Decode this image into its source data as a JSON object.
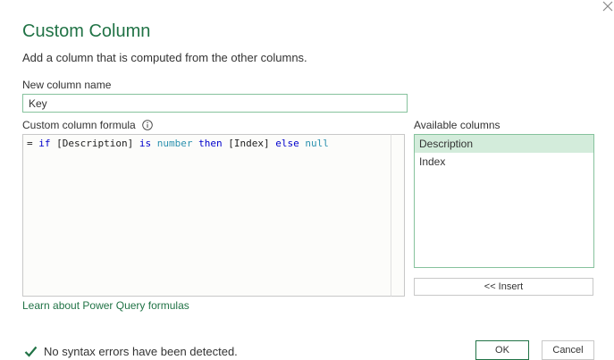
{
  "dialog": {
    "title": "Custom Column",
    "subtitle": "Add a column that is computed from the other columns."
  },
  "new_column": {
    "label": "New column name",
    "value": "Key"
  },
  "formula": {
    "label": "Custom column formula",
    "info_icon": "info-icon",
    "tokens": [
      {
        "text": "= ",
        "kind": "txt"
      },
      {
        "text": "if",
        "kind": "kw"
      },
      {
        "text": " [Description] ",
        "kind": "txt"
      },
      {
        "text": "is",
        "kind": "kw"
      },
      {
        "text": " ",
        "kind": "txt"
      },
      {
        "text": "number",
        "kind": "ty"
      },
      {
        "text": " ",
        "kind": "txt"
      },
      {
        "text": "then",
        "kind": "kw"
      },
      {
        "text": " [Index] ",
        "kind": "txt"
      },
      {
        "text": "else",
        "kind": "kw"
      },
      {
        "text": " ",
        "kind": "txt"
      },
      {
        "text": "null",
        "kind": "ty"
      }
    ]
  },
  "available_columns": {
    "label": "Available columns",
    "items": [
      {
        "label": "Description",
        "selected": true
      },
      {
        "label": "Index",
        "selected": false
      }
    ],
    "insert_label": "<< Insert"
  },
  "learn_link": "Learn about Power Query formulas",
  "status": {
    "icon": "check-icon",
    "text": "No syntax errors have been detected."
  },
  "buttons": {
    "ok": "OK",
    "cancel": "Cancel"
  },
  "colors": {
    "accent": "#217346",
    "selected_bg": "#d3ecdb",
    "keyword": "#0000cc",
    "type": "#2b91af"
  }
}
